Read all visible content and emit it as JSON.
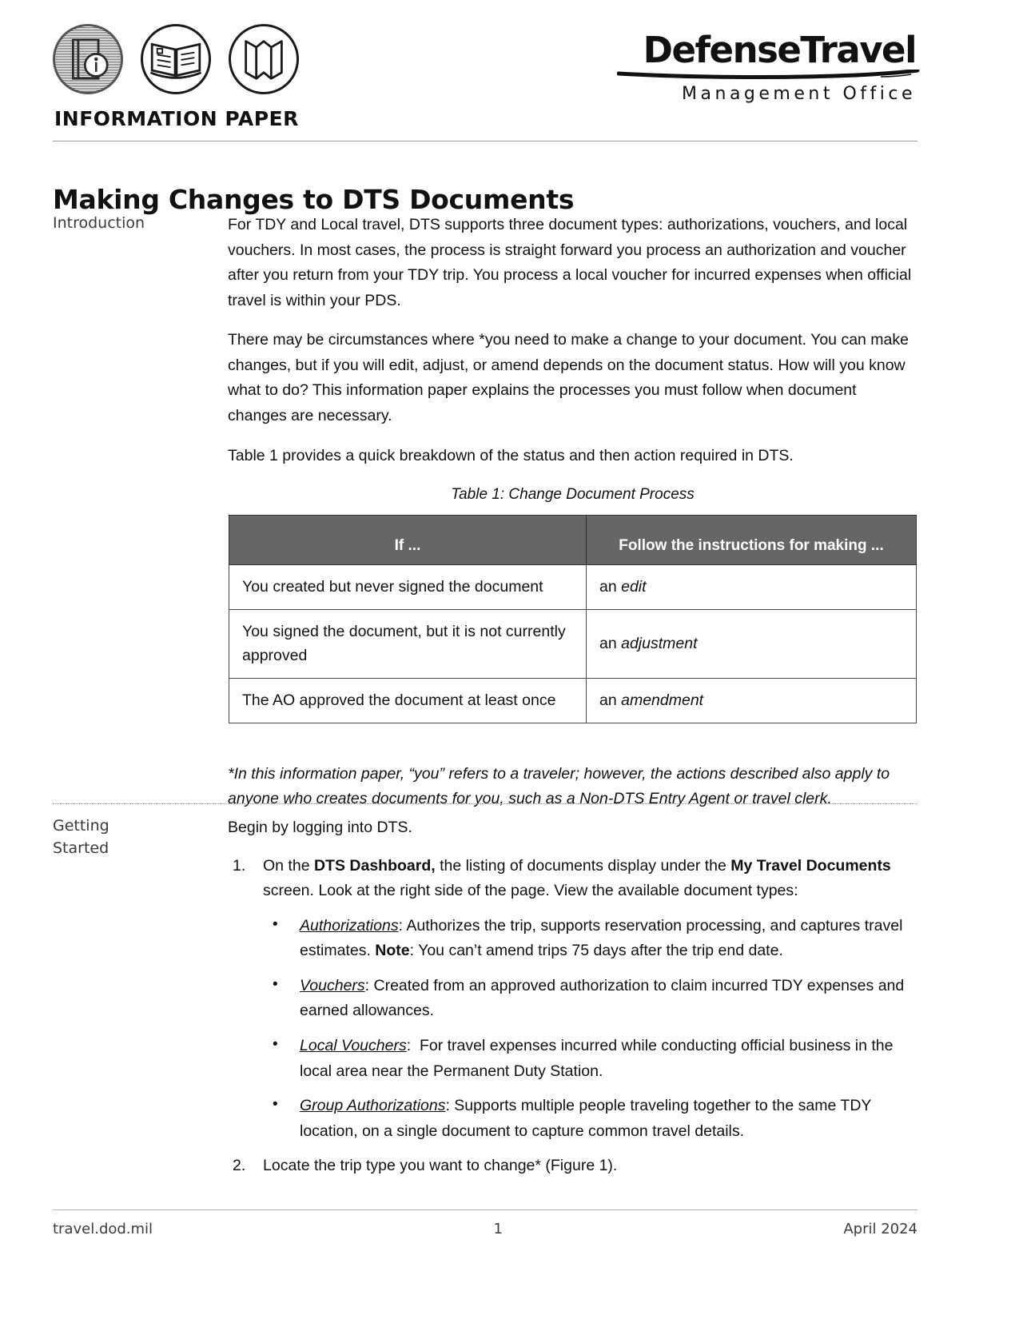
{
  "header": {
    "icons": [
      "information-circle-icon",
      "open-book-icon",
      "folded-map-icon"
    ],
    "label": "INFORMATION PAPER",
    "brand_name": "DefenseTravel",
    "brand_sub": "Management Office"
  },
  "title": "Making Changes to DTS Documents",
  "intro": {
    "side_label": "Introduction",
    "paragraph_1": "For TDY and Local travel, DTS supports three document types: authorizations, vouchers, and local vouchers. In most cases, the process is straight forward you process an authorization and voucher after you return from your TDY trip. You process a local voucher for incurred expenses when official travel is within your PDS.",
    "paragraph_2": "There may be circumstances where *you need to make a change to your document. You can make changes, but if you will edit, adjust, or amend depends on the document status. How will you know what to do? This information paper explains the processes you must follow when document changes are necessary.",
    "paragraph_3": "Table 1 provides a quick breakdown of  the status and then action required in DTS.",
    "table_caption": "Table 1: Change Document Process",
    "table": {
      "headers": [
        "If ...",
        "Follow the instructions for making ..."
      ],
      "rows": [
        {
          "condition": "You created but never signed the document",
          "action_prefix": "an ",
          "action_term": "edit"
        },
        {
          "condition": "You signed the document, but it is not currently approved",
          "action_prefix": "an ",
          "action_term": "adjustment"
        },
        {
          "condition": "The AO approved the document at least once",
          "action_prefix": "an ",
          "action_term": "amendment"
        }
      ]
    },
    "footnote": "*In this information paper, “you” refers to a traveler; however, the actions described also apply to anyone who creates documents for you, such as a Non-DTS Entry Agent or travel clerk."
  },
  "getting_started": {
    "side_label_line1": "Getting",
    "side_label_line2": "Started",
    "lead": "Begin by logging into DTS.",
    "steps": [
      {
        "number": "1.",
        "text_part_1": "On the ",
        "bold_1": "DTS Dashboard,",
        "text_part_2": " the listing of documents display under the ",
        "bold_2": "My Travel Documents",
        "text_part_3": " screen. Look at the right side of the page. View the available document types:"
      },
      {
        "number": "2.",
        "text_part_1": "Locate the trip type you want to change* (Figure 1)."
      }
    ],
    "bullets": [
      {
        "term": "Authorizations",
        "text_part_1": ": Authorizes the trip, supports reservation processing, and captures travel estimates. ",
        "bold_1": "Note",
        "text_part_2": ": You can’t amend trips 75 days after the trip end date."
      },
      {
        "term": "Vouchers",
        "text_part_1": ": Created from an approved authorization to claim incurred TDY expenses and earned allowances."
      },
      {
        "term": "Local Vouchers",
        "text_part_1": ":  For travel expenses incurred while conducting official business in the local area near the Permanent Duty Station."
      },
      {
        "term": "Group Authorizations",
        "text_part_1": ": Supports multiple people traveling together to the same TDY location, on a single document to capture common travel details."
      }
    ]
  },
  "footer": {
    "site": "travel.dod.mil",
    "page_number": "1",
    "date": "April 2024"
  }
}
